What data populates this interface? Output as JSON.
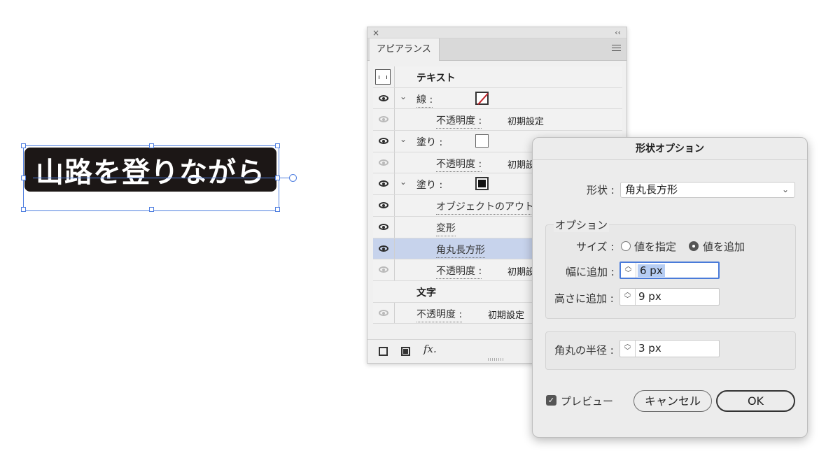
{
  "artwork": {
    "text": "山路を登りながら"
  },
  "appearance_panel": {
    "tab": "アピアランス",
    "close_glyph": "×",
    "collapse_glyph": "‹‹",
    "rows": {
      "r0": {
        "label": "テキスト"
      },
      "r1": {
        "label": "線 :"
      },
      "r2": {
        "label": "不透明度 :",
        "value": "初期設定"
      },
      "r3": {
        "label": "塗り :"
      },
      "r4": {
        "label": "不透明度 :",
        "value": "初期設定"
      },
      "r5": {
        "label": "塗り :"
      },
      "r6": {
        "label": "オブジェクトのアウトライン"
      },
      "r7": {
        "label": "変形"
      },
      "r8": {
        "label": "角丸長方形"
      },
      "r9": {
        "label": "不透明度 :",
        "value": "初期設定"
      },
      "r10": {
        "label": "文字"
      },
      "r11": {
        "label": "不透明度 :",
        "value": "初期設定"
      }
    },
    "fx_label": "fx."
  },
  "shape_dialog": {
    "title": "形状オプション",
    "shape_label": "形状 :",
    "shape_value": "角丸長方形",
    "options_legend": "オプション",
    "size_label": "サイズ :",
    "size_option_absolute": "値を指定",
    "size_option_relative": "値を追加",
    "size_selected": "relative",
    "width_label": "幅に追加 :",
    "width_value": "6 px",
    "height_label": "高さに追加 :",
    "height_value": "9 px",
    "radius_label": "角丸の半径 :",
    "radius_value": "3 px",
    "preview_label": "プレビュー",
    "preview_checked": true,
    "cancel_label": "キャンセル",
    "ok_label": "OK"
  },
  "colors": {
    "selection": "#4f7fe0",
    "selected_row": "#c7d3ec",
    "none_slash": "#c0262c"
  }
}
